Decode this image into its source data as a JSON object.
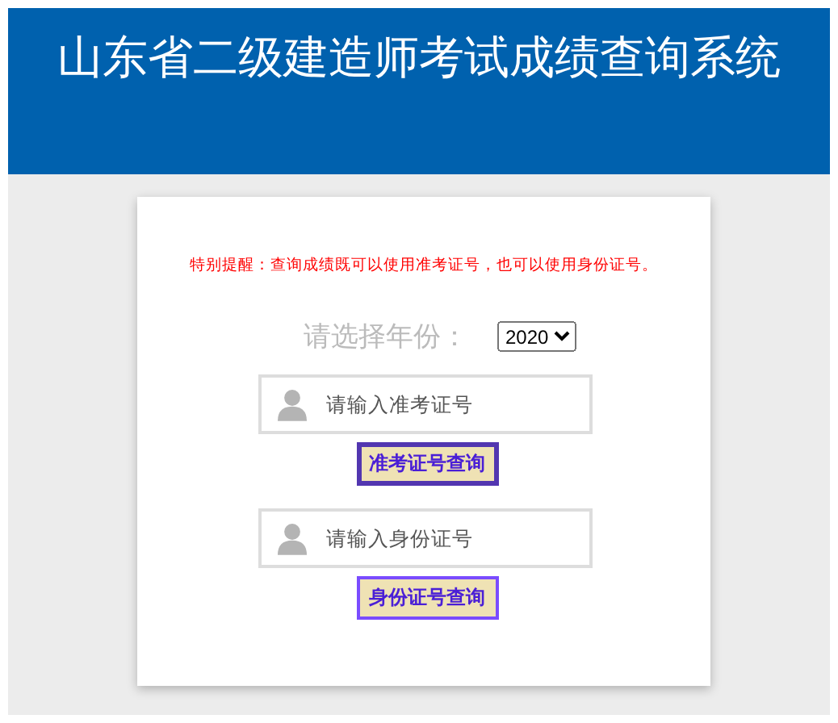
{
  "header": {
    "title": "山东省二级建造师考试成绩查询系统"
  },
  "notice": "特别提醒：查询成绩既可以使用准考证号，也可以使用身份证号。",
  "year": {
    "label": "请选择年份：",
    "value": "2020"
  },
  "queries": [
    {
      "placeholder": "请输入准考证号",
      "button": "准考证号查询",
      "focused": true
    },
    {
      "placeholder": "请输入身份证号",
      "button": "身份证号查询",
      "focused": false
    }
  ]
}
